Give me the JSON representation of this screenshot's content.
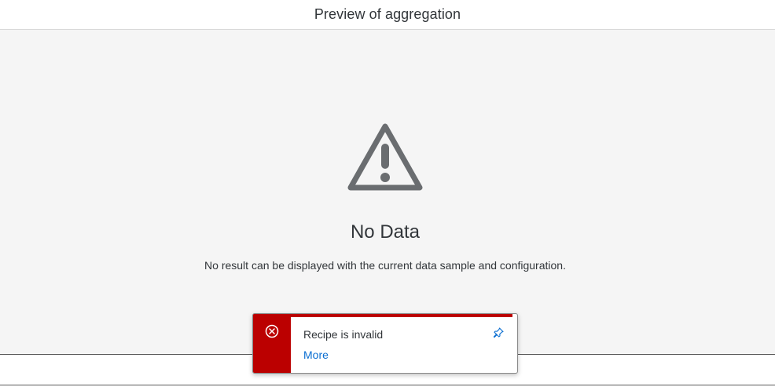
{
  "header": {
    "title": "Preview of aggregation"
  },
  "empty_state": {
    "icon": "warning-triangle-icon",
    "title": "No Data",
    "description": "No result can be displayed with the current data sample and configuration."
  },
  "toast": {
    "icon": "error-circle-icon",
    "message": "Recipe is invalid",
    "more_link": "More",
    "pin_icon": "pin-icon",
    "status_color": "#bb0000",
    "link_color": "#0a6ed1"
  },
  "colors": {
    "content_background": "#f5f5f5",
    "icon_grey": "#6a6d70",
    "text": "#32363a"
  }
}
